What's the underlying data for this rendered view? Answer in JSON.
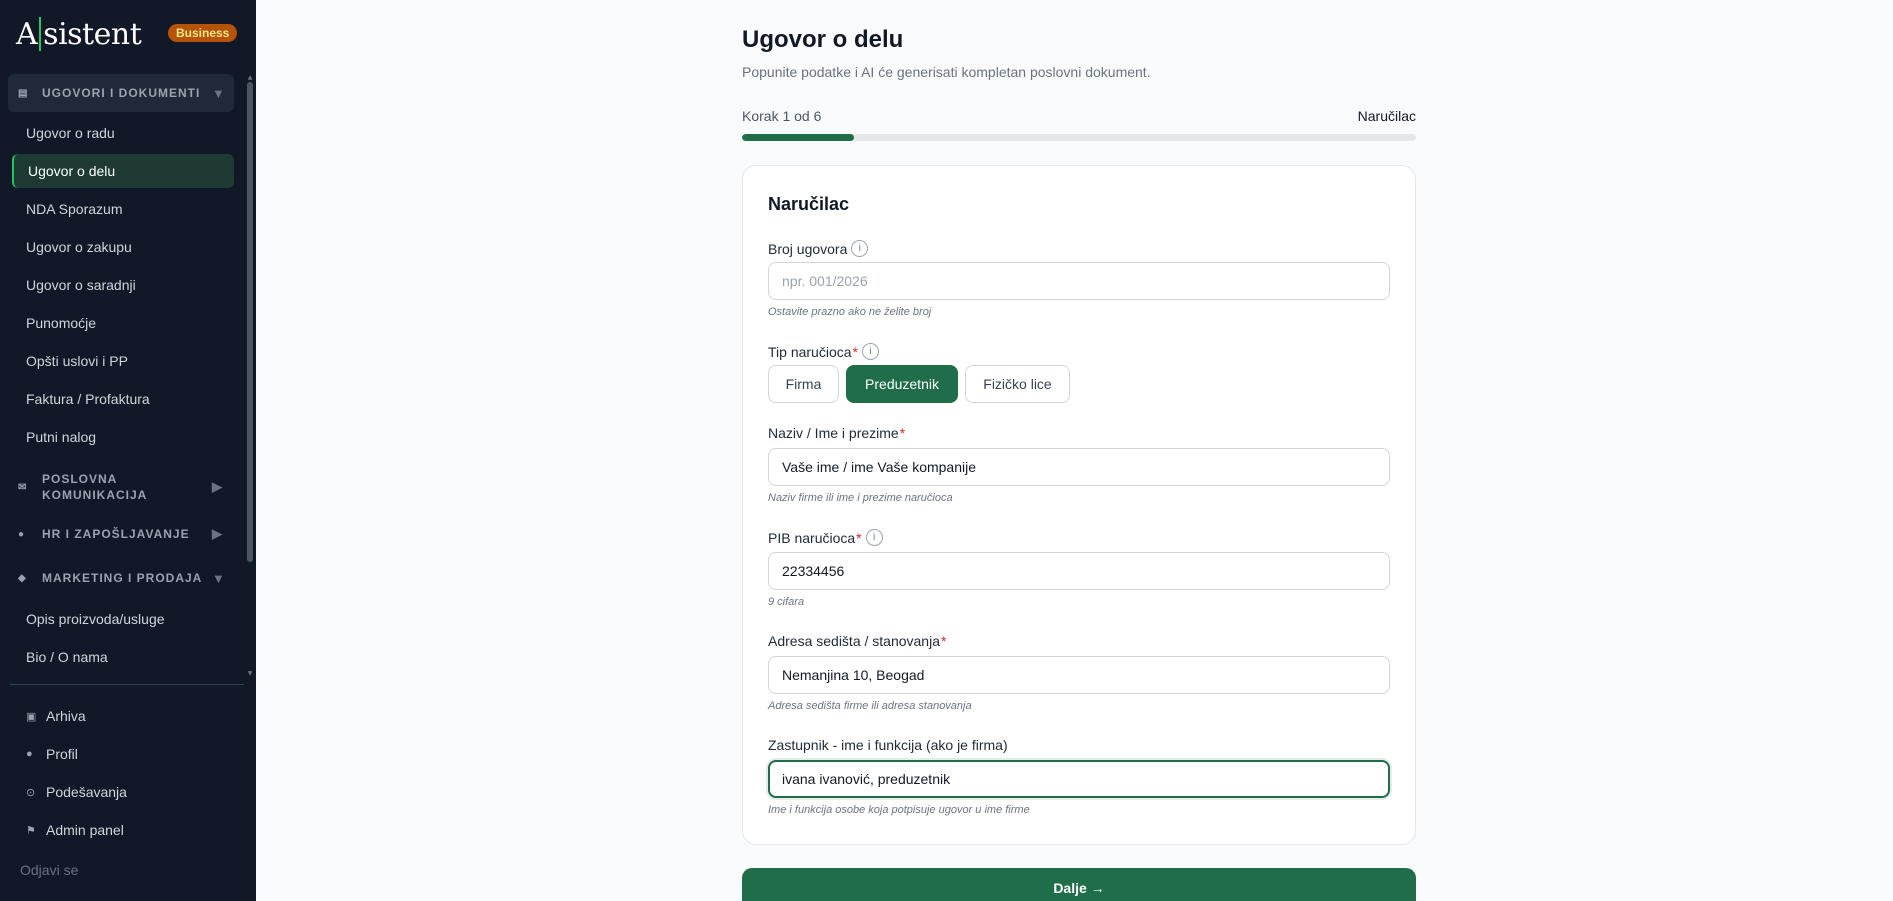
{
  "sidebar": {
    "logo_left": "A",
    "logo_right": "sistent",
    "plan_badge": "Business",
    "sections": [
      {
        "label": "UGOVORI I DOKUMENTI",
        "icon": "document-icon"
      },
      {
        "label": "POSLOVNA KOMUNIKACIJA",
        "icon": "mail-icon"
      },
      {
        "label": "HR I ZAPOŠLJAVANJE",
        "icon": "people-icon"
      },
      {
        "label": "MARKETING I PRODAJA",
        "icon": "diamond-icon"
      }
    ],
    "contracts_items": [
      {
        "label": "Ugovor o radu"
      },
      {
        "label": "Ugovor o delu"
      },
      {
        "label": "NDA Sporazum"
      },
      {
        "label": "Ugovor o zakupu"
      },
      {
        "label": "Ugovor o saradnji"
      },
      {
        "label": "Punomoćje"
      },
      {
        "label": "Opšti uslovi i PP"
      },
      {
        "label": "Faktura / Profaktura"
      },
      {
        "label": "Putni nalog"
      }
    ],
    "marketing_items": [
      {
        "label": "Opis proizvoda/usluge"
      },
      {
        "label": "Bio / O nama"
      }
    ],
    "bottom_items": [
      {
        "label": "Arhiva",
        "icon": "archive-icon"
      },
      {
        "label": "Profil",
        "icon": "user-icon"
      },
      {
        "label": "Podešavanja",
        "icon": "settings-icon"
      },
      {
        "label": "Admin panel",
        "icon": "flag-icon"
      }
    ],
    "logout": "Odjavi se"
  },
  "main": {
    "title": "Ugovor o delu",
    "subtitle": "Popunite podatke i AI će generisati kompletan poslovni dokument.",
    "step_label": "Korak 1 od 6",
    "step_name": "Naručilac",
    "progress_fraction": 0.1667,
    "card": {
      "title": "Naručilac",
      "contract_number": {
        "label": "Broj ugovora",
        "placeholder": "npr. 001/2026",
        "value": "",
        "hint": "Ostavite prazno ako ne želite broj"
      },
      "client_type": {
        "label": "Tip naručioca",
        "options": [
          "Firma",
          "Preduzetnik",
          "Fizičko lice"
        ],
        "selected": "Preduzetnik"
      },
      "name": {
        "label": "Naziv / Ime i prezime",
        "value": "Vaše ime / ime Vaše kompanije",
        "hint": "Naziv firme ili ime i prezime naručioca"
      },
      "pib": {
        "label": "PIB naručioca",
        "value": "22334456",
        "hint": "9 cifara"
      },
      "address": {
        "label": "Adresa sedišta / stanovanja",
        "value": "Nemanjina 10, Beogad",
        "hint": "Adresa sedišta firme ili adresa stanovanja"
      },
      "representative": {
        "label": "Zastupnik - ime i funkcija (ako je firma)",
        "value": "ivana ivanović, preduzetnik",
        "hint": "Ime i funkcija osobe koja potpisuje ugovor u ime firme"
      }
    },
    "next_button": "Dalje →"
  },
  "colors": {
    "sidebar_bg": "#111827",
    "accent": "#1f6e49",
    "badge": "#b45309",
    "required": "#dc2626"
  }
}
